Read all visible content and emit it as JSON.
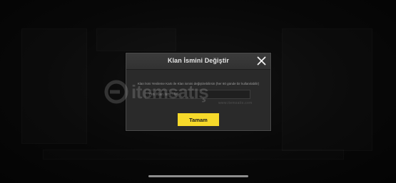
{
  "dialog": {
    "title": "Klan İsmini Değiştir",
    "description": "Klan İsmi Yenileme Kartı ile Klan ismini değiştirebilirsin (her 60 günde bir kullanılabilir)",
    "input_placeholder": "Yeni Klan İsmi : 0/6",
    "input_value": "",
    "ok_label": "Tamam",
    "close_icon": "close-icon"
  },
  "watermark": {
    "brand": "itemsatış",
    "url": "www.itemsatis.com"
  },
  "colors": {
    "accent": "#f6d92a",
    "dialog_bg": "#2a2a2a",
    "backdrop": "#0b0b0b"
  }
}
